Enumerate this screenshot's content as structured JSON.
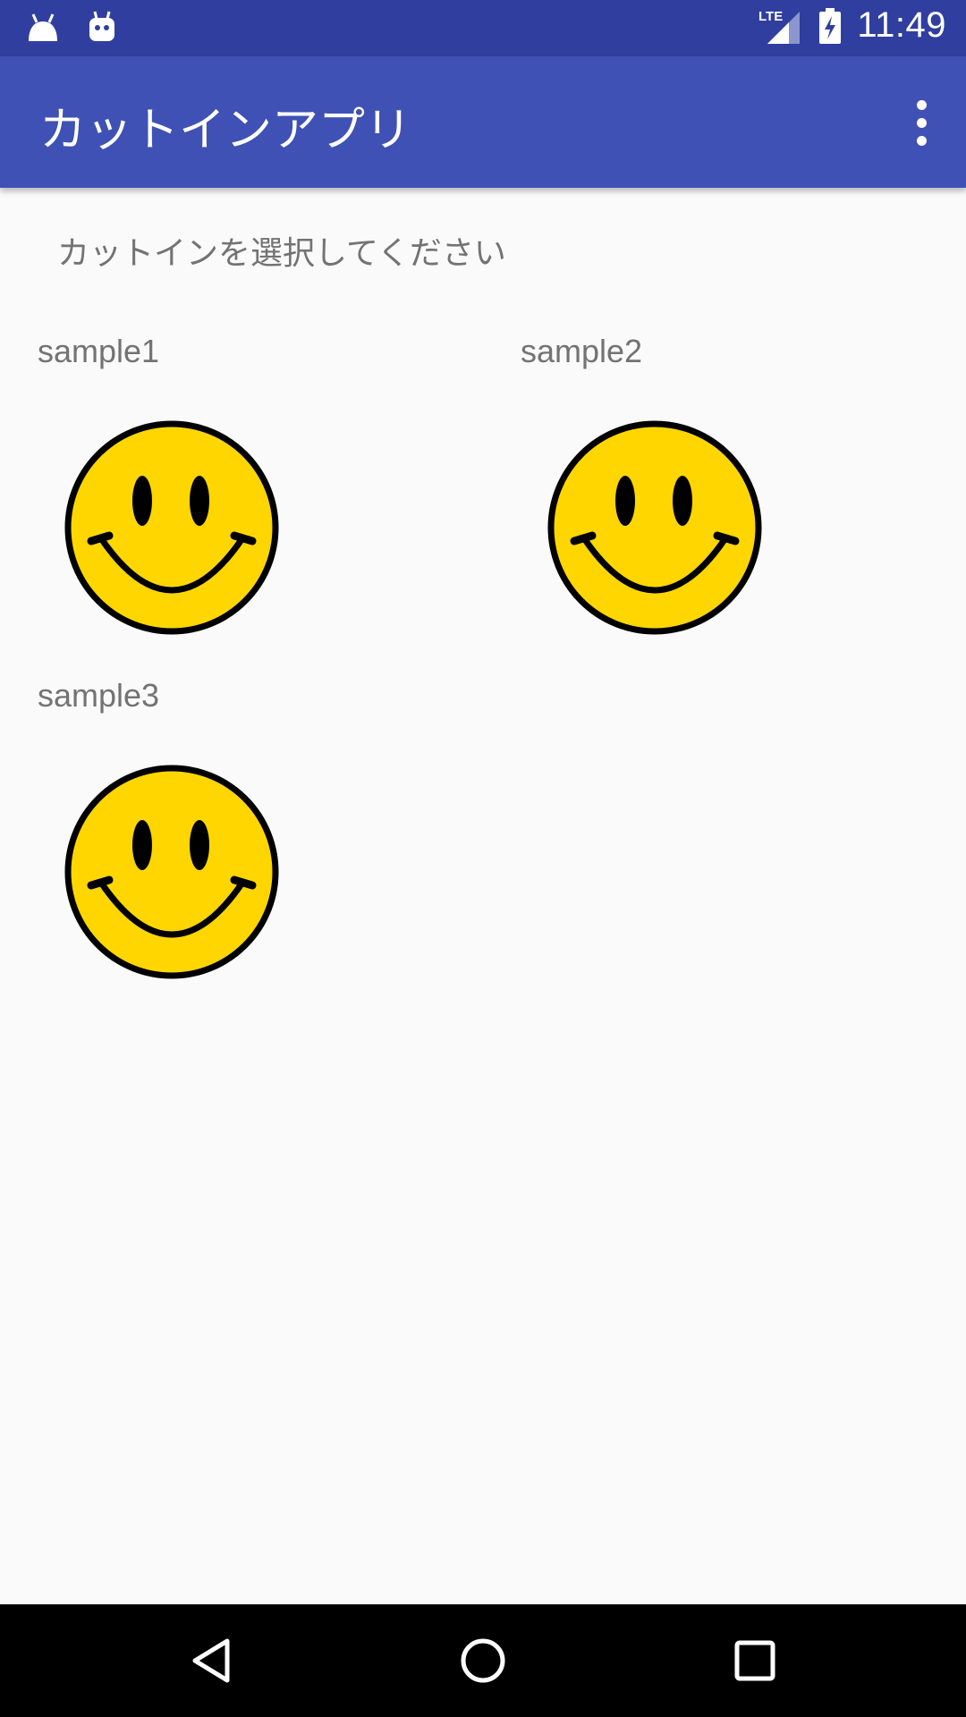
{
  "status_bar": {
    "time": "11:49",
    "network": "LTE",
    "left_icons": [
      "android-icon",
      "debug-bot-icon"
    ],
    "right_icons": [
      "lte-signal-icon",
      "battery-charging-icon"
    ]
  },
  "app_bar": {
    "title": "カットインアプリ",
    "menu_icon": "more-vert-icon"
  },
  "content": {
    "instruction": "カットインを選択してください",
    "items": [
      {
        "label": "sample1",
        "icon": "smiley-face-icon"
      },
      {
        "label": "sample2",
        "icon": "smiley-face-icon"
      },
      {
        "label": "sample3",
        "icon": "smiley-face-icon"
      }
    ]
  },
  "nav_bar": {
    "buttons": [
      "back-icon",
      "home-icon",
      "recents-icon"
    ]
  },
  "colors": {
    "status_bar": "#303f9f",
    "app_bar": "#3f51b5",
    "background": "#fafafa",
    "secondary_text": "#737373",
    "smiley_yellow": "#ffd600"
  }
}
